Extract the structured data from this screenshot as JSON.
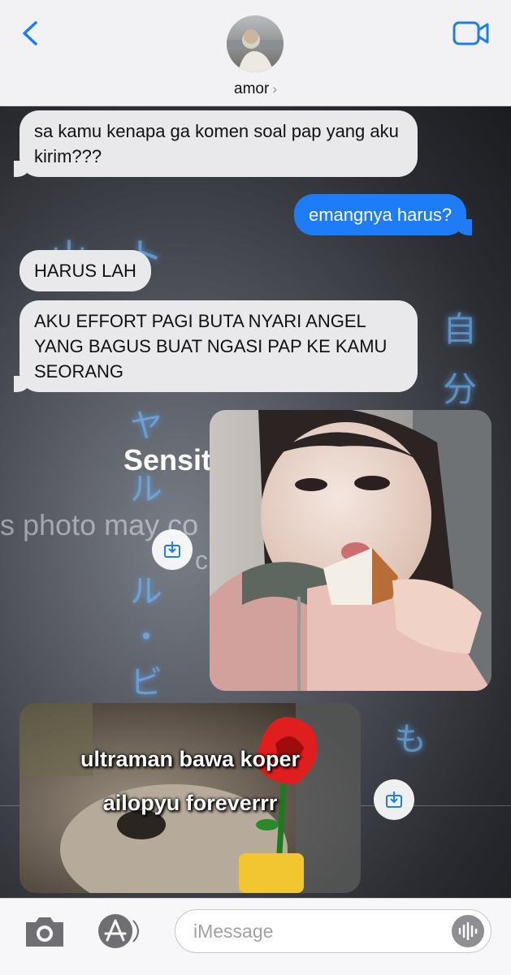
{
  "header": {
    "contact_name": "amor",
    "contact_chevron": "›",
    "icons": {
      "back": "chevron-left-icon",
      "video": "video-camera-icon"
    },
    "accent_color": "#1e7cf7"
  },
  "background": {
    "glyphs": [
      "山",
      "ト",
      "自",
      "分",
      "ヤ",
      "ル",
      "ル",
      "・",
      "ビ",
      "も"
    ],
    "watermark_word": "Sensit",
    "watermark_line": "s photo may co",
    "watermark_tail": "c"
  },
  "messages": [
    {
      "side": "in",
      "text": "sa kamu kenapa ga komen soal pap yang aku kirim???"
    },
    {
      "side": "out",
      "text": "emangnya harus?"
    },
    {
      "side": "in",
      "text": "HARUS LAH"
    },
    {
      "side": "in",
      "text": "AKU EFFORT PAGI BUTA NYARI ANGEL YANG BAGUS BUAT NGASI PAP KE KAMU SEORANG"
    }
  ],
  "meme": {
    "line1": "ultraman bawa koper",
    "line2": "ailopyu foreverrr"
  },
  "footer": {
    "placeholder": "iMessage",
    "icons": {
      "camera": "camera-icon",
      "apps": "app-store-icon",
      "audio": "audio-waveform-icon"
    }
  }
}
